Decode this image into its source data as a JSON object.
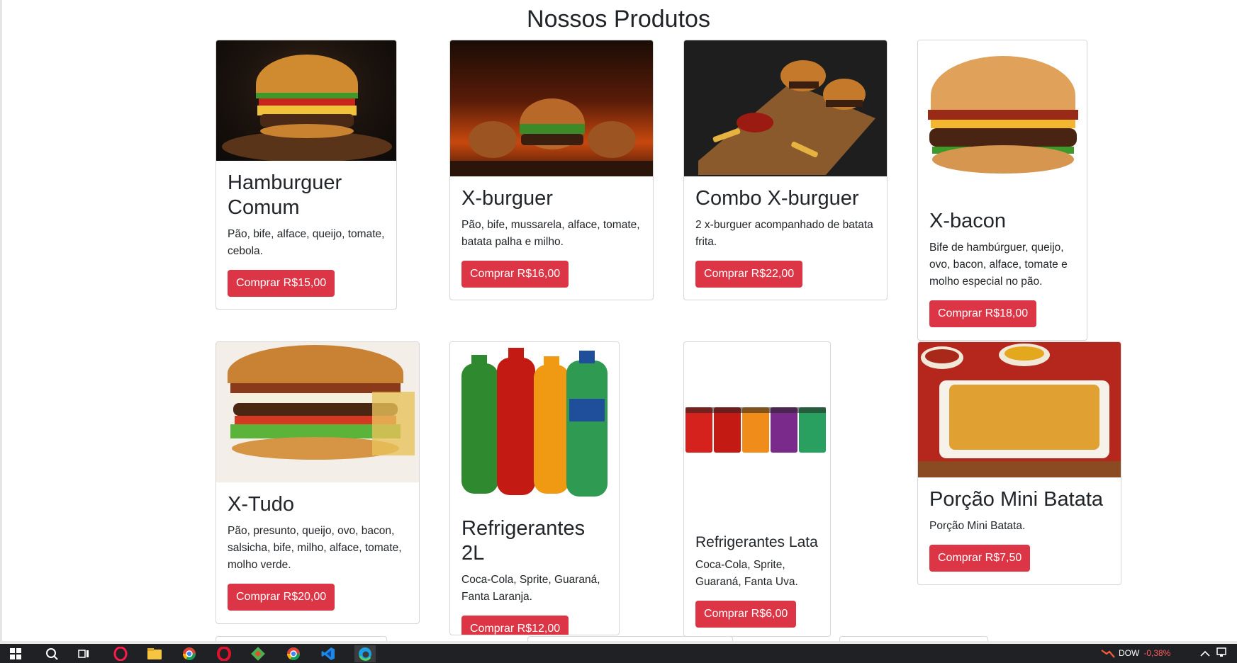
{
  "page": {
    "title": "Nossos Produtos"
  },
  "colors": {
    "button": "#dc3545",
    "taskbar": "#202124",
    "ticker_negative": "#ff5a5a"
  },
  "products": [
    {
      "title": "Hamburguer Comum",
      "description": "Pão, bife, alface, queijo, tomate, cebola.",
      "button": "Comprar R$15,00"
    },
    {
      "title": "X-burguer",
      "description": "Pão, bife, mussarela, alface, tomate, batata palha e milho.",
      "button": "Comprar R$16,00"
    },
    {
      "title": "Combo X-burguer",
      "description": "2 x-burguer acompanhado de batata frita.",
      "button": "Comprar R$22,00"
    },
    {
      "title": "X-bacon",
      "description": "Bife de hambúrguer, queijo, ovo, bacon, alface, tomate e molho especial no pão.",
      "button": "Comprar R$18,00"
    },
    {
      "title": "X-Tudo",
      "description": "Pão, presunto, queijo, ovo, bacon, salsicha, bife, milho, alface, tomate, molho verde.",
      "button": "Comprar R$20,00"
    },
    {
      "title": "Refrigerantes 2L",
      "description": "Coca-Cola, Sprite, Guaraná, Fanta Laranja.",
      "button": "Comprar R$12,00"
    },
    {
      "title": "Refrigerantes Lata",
      "description": "Coca-Cola, Sprite, Guaraná, Fanta Uva.",
      "button": "Comprar R$6,00"
    },
    {
      "title": "Porção Mini Batata",
      "description": "Porção Mini Batata.",
      "button": "Comprar R$7,50"
    }
  ],
  "taskbar": {
    "icons": [
      "windows-start-icon",
      "search-icon",
      "task-view-icon",
      "opera-gx-icon",
      "file-explorer-icon",
      "chrome-icon",
      "opera-icon",
      "git-icon",
      "chrome-icon-2",
      "vscode-icon",
      "edge-icon"
    ],
    "ticker": {
      "symbol": "DOW",
      "change": "-0,38%"
    }
  }
}
